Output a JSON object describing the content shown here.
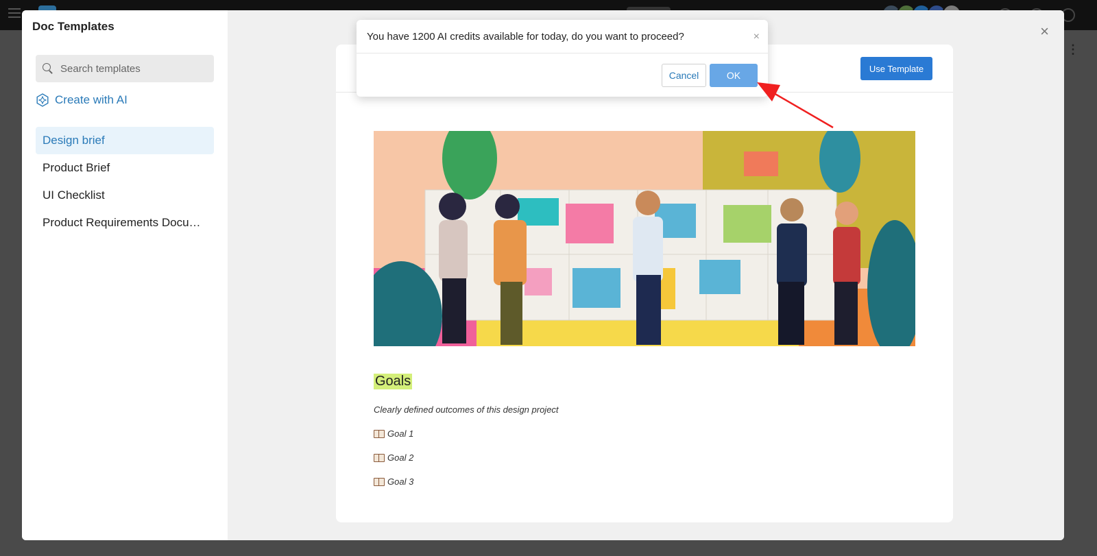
{
  "background_app": {
    "avatar_colors": [
      "#3a4a5a",
      "#4e6f3a",
      "#1f5f9a",
      "#2e4c8a",
      "#7a7a7a"
    ]
  },
  "modal": {
    "title": "Doc Templates",
    "search": {
      "placeholder": "Search templates",
      "value": ""
    },
    "create_ai_label": "Create with AI",
    "templates": [
      {
        "label": "Design brief",
        "active": true
      },
      {
        "label": "Product Brief",
        "active": false
      },
      {
        "label": "UI Checklist",
        "active": false
      },
      {
        "label": "Product Requirements Docu…",
        "active": false
      }
    ],
    "close_label": "×"
  },
  "preview": {
    "use_template_label": "Use Template",
    "doc": {
      "heading": "Goals",
      "description": "Clearly defined outcomes of this design project",
      "goals": [
        "Goal 1",
        "Goal 2",
        "Goal 3"
      ]
    }
  },
  "dialog": {
    "message": "You have 1200 AI credits available for today, do you want to proceed?",
    "close_label": "×",
    "cancel_label": "Cancel",
    "ok_label": "OK"
  },
  "colors": {
    "accent": "#2a7ab8",
    "primary_button": "#2a7ad4",
    "ok_button": "#68a7e6",
    "highlight": "#d4ef7a",
    "annotation_arrow": "#f02020"
  },
  "icons": {
    "search": "search-icon",
    "ai": "ai-sparkle-icon",
    "close": "close-icon",
    "goal": "book-icon"
  }
}
